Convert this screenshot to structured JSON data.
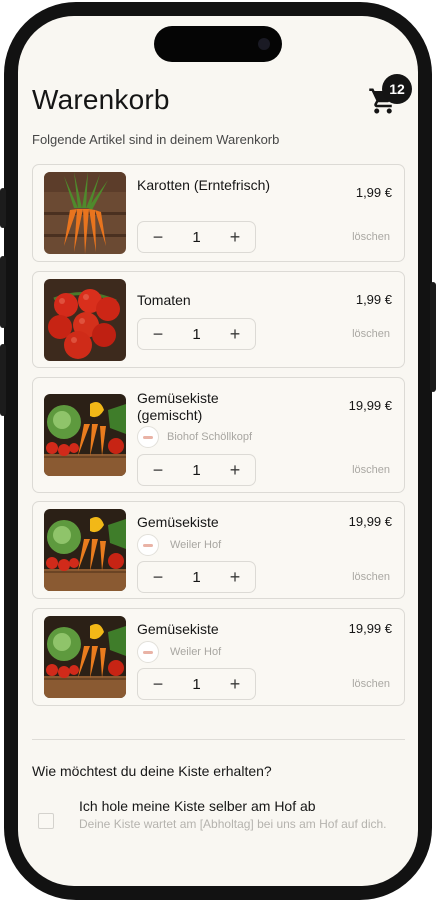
{
  "header": {
    "title": "Warenkorb",
    "subtitle": "Folgende Artikel sind in deinem Warenkorb",
    "cart_count": "12"
  },
  "cart": {
    "items": [
      {
        "name": "Karotten (Erntefrisch)",
        "price": "1,99 €",
        "quantity": "1",
        "farm": "",
        "image": "carrots",
        "delete_label": "löschen"
      },
      {
        "name": "Tomaten",
        "price": "1,99 €",
        "quantity": "1",
        "farm": "",
        "image": "tomatoes",
        "delete_label": "löschen"
      },
      {
        "name": "Gemüsekiste (gemischt)",
        "price": "19,99 €",
        "quantity": "1",
        "farm": "Biohof Schöllkopf",
        "image": "vegetable-box",
        "delete_label": "löschen"
      },
      {
        "name": "Gemüsekiste",
        "price": "19,99 €",
        "quantity": "1",
        "farm": "Weiler Hof",
        "image": "vegetable-box",
        "delete_label": "löschen"
      },
      {
        "name": "Gemüsekiste",
        "price": "19,99 €",
        "quantity": "1",
        "farm": "Weiler Hof",
        "image": "vegetable-box",
        "delete_label": "löschen"
      }
    ],
    "minus_symbol": "−",
    "plus_symbol": "+"
  },
  "delivery": {
    "question": "Wie möchtest du deine Kiste erhalten?",
    "pickup_title": "Ich hole meine Kiste selber am Hof ab",
    "pickup_description": "Deine Kiste wartet am [Abholtag] bei uns am Hof auf dich.",
    "pickup_checked": false
  },
  "icons": {
    "cart": "shopping-cart-icon",
    "farm_logo": "farm-logo-icon"
  },
  "colors": {
    "background": "#f9f7f2",
    "badge": "#141414",
    "muted_text": "#aaa8a3"
  }
}
